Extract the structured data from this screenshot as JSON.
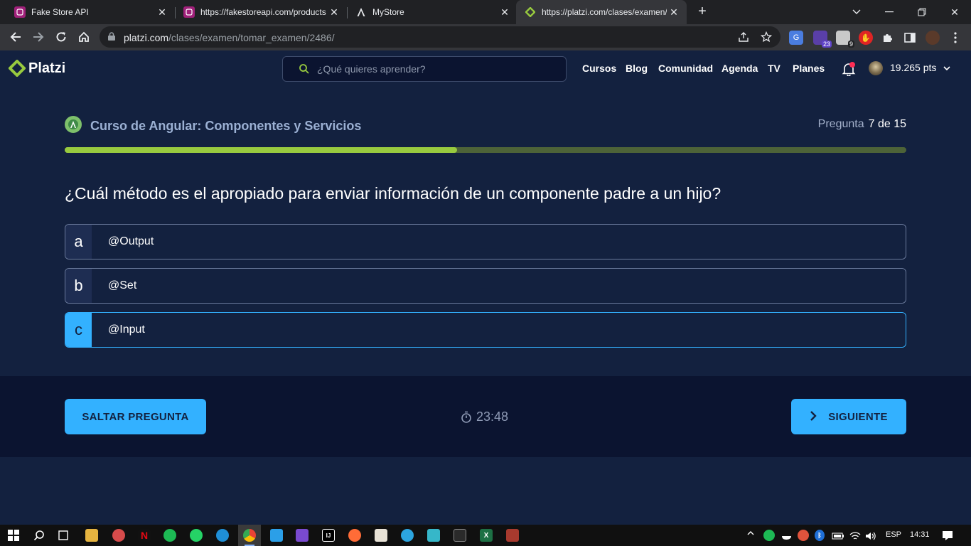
{
  "browser": {
    "tabs": [
      {
        "title": "Fake Store API",
        "favicon": "fakestore-icon",
        "active": false
      },
      {
        "title": "https://fakestoreapi.com/products",
        "favicon": "fakestore-icon",
        "active": false
      },
      {
        "title": "MyStore",
        "favicon": "angular-icon",
        "active": false
      },
      {
        "title": "https://platzi.com/clases/examen/tomar",
        "favicon": "platzi-icon",
        "active": true
      }
    ],
    "url_host": "platzi.com",
    "url_path": "/clases/examen/tomar_examen/2486/",
    "extension_badges": [
      "23",
      "9"
    ]
  },
  "header": {
    "logo_text": "Platzi",
    "search_placeholder": "¿Qué quieres aprender?",
    "nav": [
      "Cursos",
      "Blog",
      "Comunidad",
      "Agenda",
      "TV",
      "Planes"
    ],
    "points": "19.265 pts"
  },
  "exam": {
    "course_title": "Curso de Angular: Componentes y Servicios",
    "question_label": "Pregunta",
    "question_progress": "7 de 15",
    "progress_fraction": 0.466,
    "question_text": "¿Cuál método es el apropiado para enviar información de un componente padre a un hijo?",
    "options": [
      {
        "letter": "a",
        "text": "@Output",
        "selected": false
      },
      {
        "letter": "b",
        "text": "@Set",
        "selected": false
      },
      {
        "letter": "c",
        "text": "@Input",
        "selected": true
      }
    ]
  },
  "footer": {
    "skip_label": "SALTAR PREGUNTA",
    "timer": "23:48",
    "next_label": "SIGUIENTE"
  },
  "taskbar": {
    "time": "14:31",
    "language": "ESP"
  },
  "colors": {
    "background": "#13213f",
    "accent": "#33b1ff",
    "progress": "#98ca3f",
    "footer": "#0b1430"
  }
}
